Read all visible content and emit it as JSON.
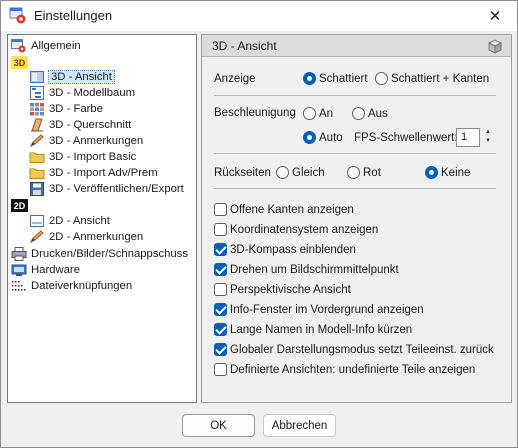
{
  "window": {
    "title": "Einstellungen",
    "close_icon": "close-icon"
  },
  "tree": {
    "items": [
      {
        "label": "Allgemein",
        "icon": "settings-icon"
      },
      {
        "badge": "3D"
      },
      {
        "label": "3D - Ansicht",
        "icon": "view-icon",
        "selected": true
      },
      {
        "label": "3D - Modellbaum",
        "icon": "model-tree-icon"
      },
      {
        "label": "3D - Farbe",
        "icon": "color-grid-icon"
      },
      {
        "label": "3D - Querschnitt",
        "icon": "cross-section-icon"
      },
      {
        "label": "3D - Anmerkungen",
        "icon": "pencil-icon"
      },
      {
        "label": "3D - Import Basic",
        "icon": "folder-icon"
      },
      {
        "label": "3D - Import Adv/Prem",
        "icon": "folder-icon"
      },
      {
        "label": "3D - Veröffentlichen/Export",
        "icon": "save-icon"
      },
      {
        "badge": "2D"
      },
      {
        "label": "2D - Ansicht",
        "icon": "view-icon"
      },
      {
        "label": "2D - Anmerkungen",
        "icon": "pencil-icon"
      },
      {
        "label": "Drucken/Bilder/Schnappschuss",
        "icon": "printer-icon"
      },
      {
        "label": "Hardware",
        "icon": "hardware-icon"
      },
      {
        "label": "Dateiverknüpfungen",
        "icon": "file-links-icon"
      }
    ]
  },
  "panel": {
    "title": "3D - Ansicht",
    "anzeige": {
      "label": "Anzeige",
      "options": [
        "Schattiert",
        "Schattiert + Kanten"
      ],
      "selected": "Schattiert"
    },
    "beschleunigung": {
      "label": "Beschleunigung",
      "options": [
        "An",
        "Aus",
        "Auto"
      ],
      "selected": "Auto",
      "fps_label": "FPS-Schwellenwert:",
      "fps_value": "1"
    },
    "rueckseiten": {
      "label": "Rückseiten",
      "options": [
        "Gleich",
        "Rot",
        "Keine"
      ],
      "selected": "Keine"
    },
    "checkboxes": [
      {
        "label": "Offene Kanten anzeigen",
        "checked": false
      },
      {
        "label": "Koordinatensystem anzeigen",
        "checked": false
      },
      {
        "label": "3D-Kompass einblenden",
        "checked": true
      },
      {
        "label": "Drehen um Bildschirmmittelpunkt",
        "checked": true
      },
      {
        "label": "Perspektivische Ansicht",
        "checked": false
      },
      {
        "label": "Info-Fenster im Vordergrund anzeigen",
        "checked": true
      },
      {
        "label": "Lange Namen in Modell-Info kürzen",
        "checked": true
      },
      {
        "label": "Globaler Darstellungsmodus setzt Teileeinst. zurück",
        "checked": true
      },
      {
        "label": "Definierte Ansichten: undefinierte Teile anzeigen",
        "checked": false
      }
    ]
  },
  "footer": {
    "ok_label": "OK",
    "cancel_label": "Abbrechen"
  },
  "colors": {
    "accent": "#005fb8",
    "selection": "#cce8ff"
  }
}
